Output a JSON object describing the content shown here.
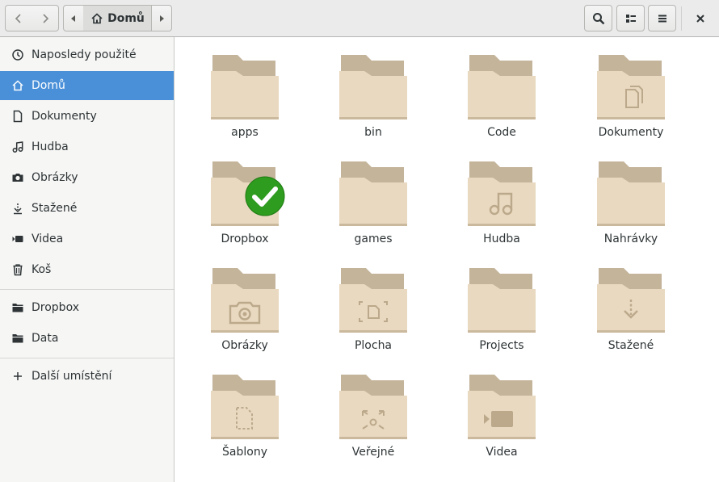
{
  "header": {
    "path_home_label": "Domů"
  },
  "sidebar": {
    "items": [
      {
        "label": "Naposledy použité",
        "icon": "clock-icon"
      },
      {
        "label": "Domů",
        "icon": "home-icon",
        "active": true
      },
      {
        "label": "Dokumenty",
        "icon": "document-icon"
      },
      {
        "label": "Hudba",
        "icon": "music-icon"
      },
      {
        "label": "Obrázky",
        "icon": "camera-icon"
      },
      {
        "label": "Stažené",
        "icon": "download-icon"
      },
      {
        "label": "Videa",
        "icon": "video-icon"
      },
      {
        "label": "Koš",
        "icon": "trash-icon"
      },
      {
        "label": "Dropbox",
        "icon": "folder-icon"
      },
      {
        "label": "Data",
        "icon": "folder-icon"
      },
      {
        "label": "Další umístění",
        "icon": "plus-icon"
      }
    ]
  },
  "folders": [
    {
      "label": "apps",
      "emblem": "none"
    },
    {
      "label": "bin",
      "emblem": "none"
    },
    {
      "label": "Code",
      "emblem": "none"
    },
    {
      "label": "Dokumenty",
      "emblem": "documents"
    },
    {
      "label": "Dropbox",
      "emblem": "sync-check"
    },
    {
      "label": "games",
      "emblem": "none"
    },
    {
      "label": "Hudba",
      "emblem": "music"
    },
    {
      "label": "Nahrávky",
      "emblem": "none"
    },
    {
      "label": "Obrázky",
      "emblem": "camera"
    },
    {
      "label": "Plocha",
      "emblem": "desktop"
    },
    {
      "label": "Projects",
      "emblem": "none"
    },
    {
      "label": "Stažené",
      "emblem": "download"
    },
    {
      "label": "Šablony",
      "emblem": "template"
    },
    {
      "label": "Veřejné",
      "emblem": "share"
    },
    {
      "label": "Videa",
      "emblem": "video"
    }
  ],
  "colors": {
    "accent": "#4a90d9",
    "folder_back": "#c4b49a",
    "folder_front": "#e9d9c0",
    "folder_glyph": "#bca98b",
    "check_green": "#2e9c1e"
  }
}
